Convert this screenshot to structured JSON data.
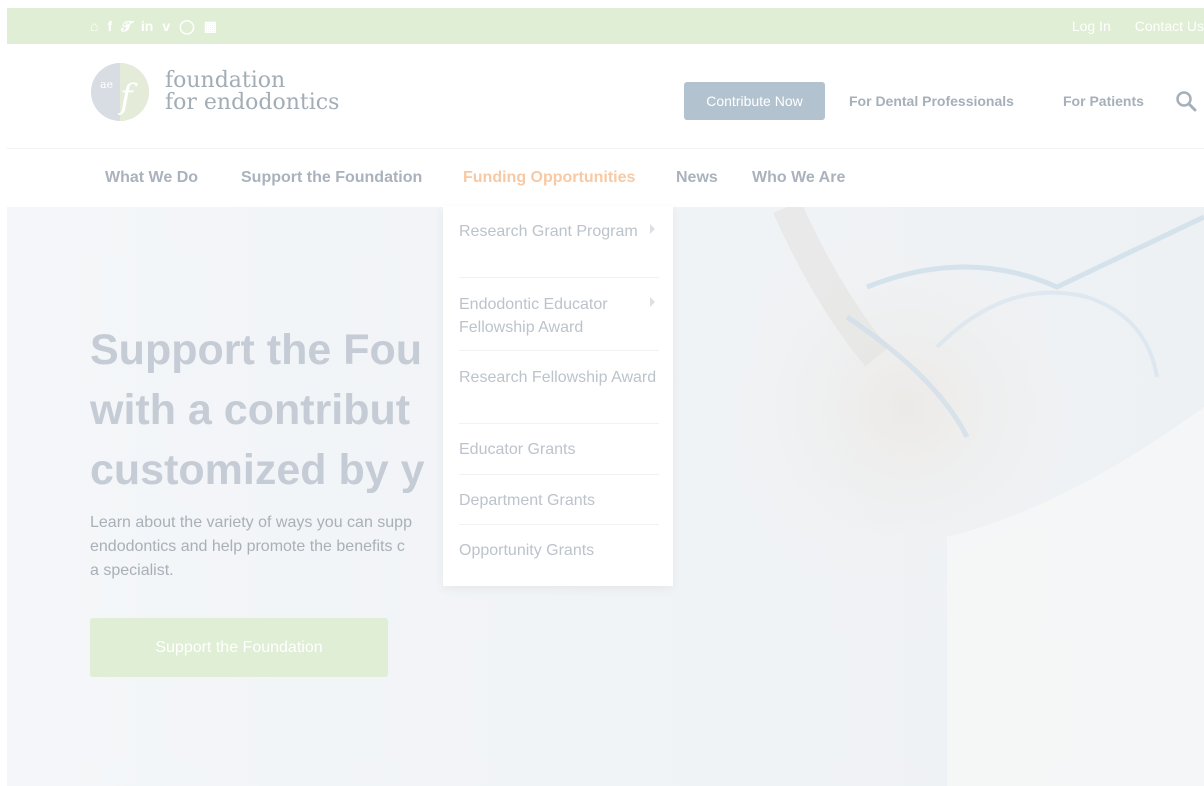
{
  "top_bar": {
    "social_icons": [
      "home-icon",
      "facebook-icon",
      "twitter-icon",
      "linkedin-icon",
      "vimeo-icon",
      "instagram-icon",
      "chat-icon"
    ],
    "log_in": "Log In",
    "contact_us": "Contact Us"
  },
  "header": {
    "logo_line1": "foundation",
    "logo_line2": "for endodontics",
    "contribute": "Contribute Now",
    "dental_professionals": "For Dental Professionals",
    "patients": "For Patients"
  },
  "nav": {
    "items": [
      "What We Do",
      "Support the Foundation",
      "Funding Opportunities",
      "News",
      "Who We Are"
    ],
    "active": "Funding Opportunities"
  },
  "dropdown": {
    "items": [
      "Research Grant Program",
      "Endodontic Educator Fellowship Award",
      "Research Fellowship Award",
      "Educator Grants",
      "Department Grants",
      "Opportunity Grants"
    ]
  },
  "hero": {
    "heading_line1": "Support the Fou",
    "heading_line2": "with a contribut",
    "heading_line3": "customized by y",
    "body_line1": "Learn about the variety of ways you can supp",
    "body_line2": "endodontics and help promote the benefits c",
    "body_line3": "a specialist.",
    "button": "Support the Foundation"
  },
  "colors": {
    "top_bar_bg": "#dfeed4",
    "nav_active": "#f8c9a3",
    "contribute_bg": "#b3c2cf",
    "hero_button_bg": "#dfeed4"
  }
}
